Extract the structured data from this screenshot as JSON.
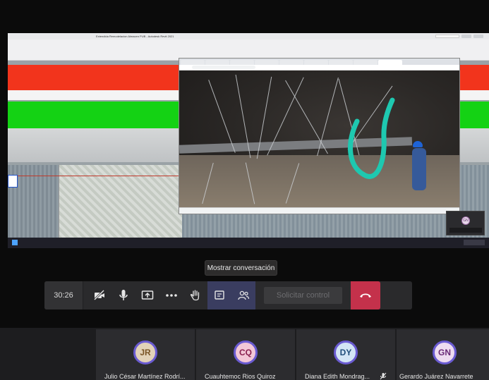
{
  "shared_screen": {
    "title": "Extendida Remodelacion Almacen PUB - Autodesk Revit 2021"
  },
  "tooltip": {
    "text": "Mostrar conversación"
  },
  "controls": {
    "timer": "30:26",
    "solicit_label": "Solicitar control",
    "icons": [
      "camera-off-icon",
      "mic-icon",
      "share-screen-icon",
      "more-icon",
      "raise-hand-icon",
      "chat-icon",
      "participants-icon",
      "hang-up-icon"
    ]
  },
  "pip": {
    "initials": "GN"
  },
  "participants": [
    {
      "initials": "JR",
      "name": "Julio César Martínez Rodrí...",
      "avatar_bg": "#e2d2b8",
      "initials_color": "#7a5526"
    },
    {
      "initials": "CQ",
      "name": "Cuauhtemoc Rios Quiroz",
      "avatar_bg": "#f3c8d8",
      "initials_color": "#8a2150"
    },
    {
      "initials": "DY",
      "name": "Diana Edith Mondrag...",
      "avatar_bg": "#d3e5f5",
      "initials_color": "#1f4d7a",
      "muted": true
    },
    {
      "initials": "GN",
      "name": "Gerardo Juárez Navarrete",
      "avatar_bg": "#eedcf0",
      "initials_color": "#6a2a77"
    }
  ],
  "colors": {
    "accent": "#6264a7",
    "hangup": "#c4314b",
    "annotation": "#1ec8b0"
  }
}
